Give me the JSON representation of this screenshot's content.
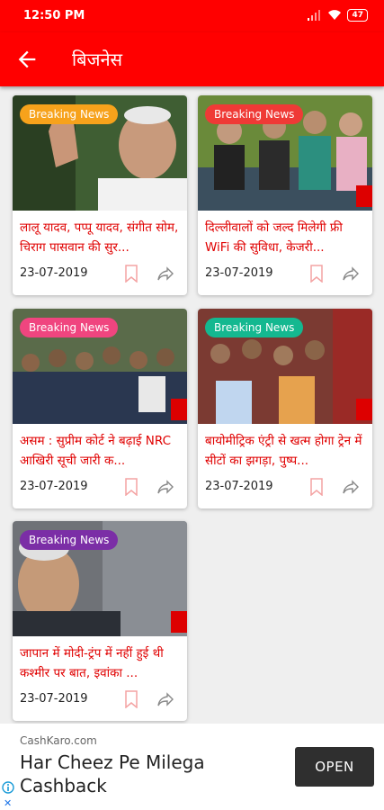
{
  "status": {
    "time": "12:50 PM",
    "battery": "47"
  },
  "appbar": {
    "title": "बिजनेस"
  },
  "cards": [
    {
      "badge": "Breaking News",
      "badge_color": "#f7a21b",
      "headline": "लालू यादव, पप्पू यादव, संगीत सोम, चिराग पासवान की सुर...",
      "date": "23-07-2019"
    },
    {
      "badge": "Breaking News",
      "badge_color": "#ef3a36",
      "headline": "दिल्लीवालों को जल्द मिलेगी फ्री WiFi की सुविधा, केजरी...",
      "date": "23-07-2019"
    },
    {
      "badge": "Breaking News",
      "badge_color": "#f0457f",
      "headline": "असम : सुप्रीम कोर्ट ने बढ़ाई NRC आखिरी सूची जारी क...",
      "date": "23-07-2019"
    },
    {
      "badge": "Breaking News",
      "badge_color": "#14b890",
      "headline": "बायोमीट्रिक एंट्री से खत्म होगा ट्रेन में सीटों का झगड़ा, पुष्प...",
      "date": "23-07-2019"
    },
    {
      "badge": "Breaking News",
      "badge_color": "#7b2ea6",
      "headline": "जापान में मोदी-ट्रंप में नहीं हुई थी कश्मीर पर बात, इवांका ...",
      "date": "23-07-2019"
    }
  ],
  "ad": {
    "source": "CashKaro.com",
    "headline": "Har Cheez Pe Milega Cashback",
    "button": "OPEN"
  },
  "colors": {
    "brand": "#ff0000",
    "headline": "#e00000"
  }
}
